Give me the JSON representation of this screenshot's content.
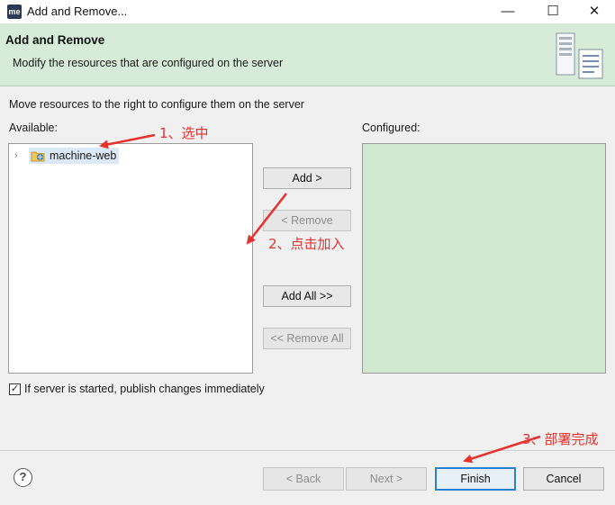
{
  "window": {
    "app_icon_text": "me",
    "title": "Add and Remove...",
    "minimize": "—",
    "maximize": "☐",
    "close": "✕"
  },
  "banner": {
    "title": "Add and Remove",
    "description": "Modify the resources that are configured on the server"
  },
  "instruction": "Move resources to the right to configure them on the server",
  "available": {
    "label": "Available:",
    "items": [
      {
        "label": "machine-web",
        "expanded": false,
        "selected": true
      }
    ]
  },
  "configured": {
    "label": "Configured:",
    "items": []
  },
  "buttons": {
    "add": "Add >",
    "remove": "< Remove",
    "add_all": "Add All >>",
    "remove_all": "<< Remove All"
  },
  "publish_checkbox": {
    "label": "If server is started, publish changes immediately",
    "checked": true
  },
  "footer": {
    "help": "?",
    "back": "< Back",
    "next": "Next >",
    "finish": "Finish",
    "cancel": "Cancel"
  },
  "annotations": {
    "step1": "1、选中",
    "step2": "2、点击加入",
    "step3": "3、部署完成",
    "color": "#e8302c"
  },
  "colors": {
    "banner_bg": "#d6ecd9",
    "configured_bg": "#cfe8cf",
    "finish_border": "#2b7fd4"
  }
}
